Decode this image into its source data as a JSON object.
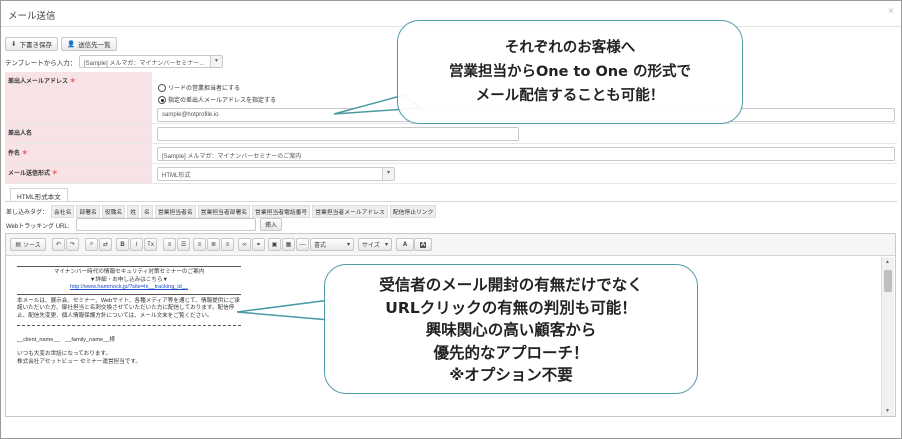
{
  "window": {
    "title": "メール送信",
    "close_glyph": "×"
  },
  "toolbar": {
    "draft_save": "下書き保存",
    "recipients_list": "送信先一覧"
  },
  "template": {
    "label": "テンプレートから入力：",
    "selected": "[Sample] メルマガ：マイナンバーセミナー..."
  },
  "form": {
    "sender_address": {
      "label": "差出人メールアドレス",
      "required_mark": "＊",
      "option_owner": "リードの営業担当者にする",
      "option_fixed": "指定の差出人メールアドレスを指定する",
      "selected_option": "fixed",
      "value": "sample@hotprofile.io"
    },
    "sender_name": {
      "label": "差出人名",
      "value": ""
    },
    "subject": {
      "label": "件名",
      "required_mark": "＊",
      "value": "[Sample] メルマガ：マイナンバーセミナーのご案内"
    },
    "format": {
      "label": "メール送信形式",
      "required_mark": "＊",
      "value": "HTML形式"
    }
  },
  "tabs": {
    "active": "HTML形式本文"
  },
  "merge_tags": {
    "label": "差し込みタグ：",
    "items": [
      "会社名",
      "部署名",
      "役職名",
      "姓",
      "名",
      "営業担当者名",
      "営業担当者部署名",
      "営業担当者電話番号",
      "営業担当者メールアドレス",
      "配信停止リンク"
    ]
  },
  "web_tracking": {
    "label": "Webトラッキング URL:",
    "value": "",
    "insert_label": "挿入"
  },
  "editor_toolbar": {
    "source_label": "ソース",
    "format_label": "書式",
    "size_label": "サイズ",
    "bold": "B",
    "italic": "I",
    "underline": "U",
    "strike": "Tx",
    "text_color": "A",
    "bg_color": "A"
  },
  "mail_body": {
    "line1": "マイナンバー時代の情報セキュリティ対策セミナーのご案内",
    "line2": "▼詳細・お申し込みはこちら▼",
    "link": "http://www.hammock.jp/?site=hi__tracking_id__",
    "para1": "本メールは、展示会、セミナー、Webサイト、各種メディア等を通じて、情報提供にご承諾いただいた方、御社担当と名刺交換させていただいた方に配信しております。配信停止、配信先変更、個人情報保護方針については、メール文末をご覧ください。",
    "salutation_line": "__client_name__　__family_name__様",
    "greeting1": "いつも大変お世話になっております。",
    "greeting2": "株式会社アセットビュー セミナー運営担当です。"
  },
  "callouts": {
    "top": [
      "それぞれのお客様へ",
      "営業担当からOne to One の形式で",
      "メール配信することも可能！"
    ],
    "bottom": [
      "受信者のメール開封の有無だけでなく",
      "URLクリックの有無の判別も可能！",
      "興味関心の高い顧客から",
      "優先的なアプローチ！",
      "※オプション不要"
    ]
  },
  "colors": {
    "label_bg": "#f7e3e5",
    "required": "#d9534f",
    "bubble_border": "#4a9aa5",
    "link": "#1a4fc4"
  }
}
